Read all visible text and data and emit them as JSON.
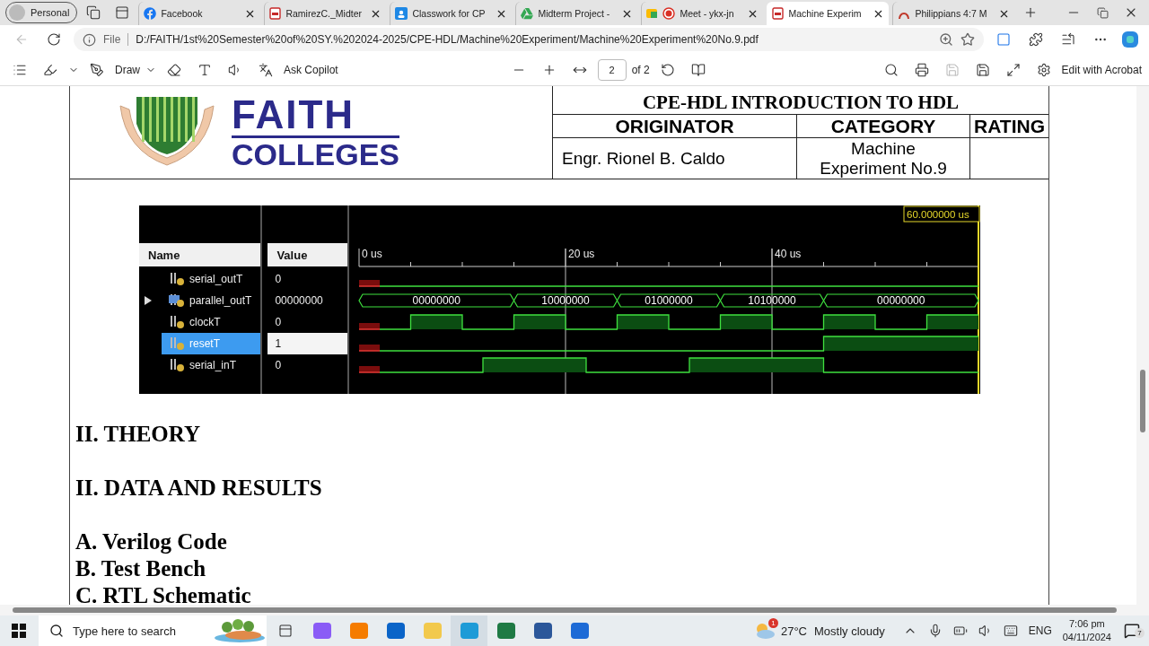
{
  "browser": {
    "profile": "Personal",
    "tabs": [
      {
        "label": "Facebook",
        "kind": "social",
        "selected": false
      },
      {
        "label": "RamirezC._Midter",
        "kind": "pdf",
        "selected": false
      },
      {
        "label": "Classwork for CP",
        "kind": "classroom",
        "selected": false
      },
      {
        "label": "Midterm Project -",
        "kind": "drive",
        "selected": false
      },
      {
        "label": "Meet - ykx-jn",
        "kind": "meet",
        "selected": false
      },
      {
        "label": "Machine Experim",
        "kind": "pdf",
        "selected": true
      },
      {
        "label": "Philippians 4:7 M",
        "kind": "arc",
        "selected": false
      }
    ],
    "address": {
      "scheme": "File",
      "url": "D:/FAITH/1st%20Semester%20of%20SY.%202024-2025/CPE-HDL/Machine%20Experiment/Machine%20Experiment%20No.9.pdf"
    }
  },
  "pdf_toolbar": {
    "draw": "Draw",
    "copilot": "Ask Copilot",
    "page": "2",
    "page_count": "of 2",
    "acrobat": "Edit with Acrobat"
  },
  "document": {
    "logo_top": "FAITH",
    "logo_bottom": "COLLEGES",
    "course": "CPE-HDL INTRODUCTION TO HDL",
    "columns": [
      "ORIGINATOR",
      "CATEGORY",
      "RATING"
    ],
    "values": [
      "Engr. Rionel B. Caldo",
      "Machine Experiment No.9"
    ],
    "simulation": {
      "name_header": "Name",
      "value_header": "Value",
      "time_labels": [
        "0 us",
        "20 us",
        "40 us"
      ],
      "cursor": "60.000000 us",
      "signals": [
        {
          "name": "serial_outT",
          "value": "0",
          "kind": "bit",
          "selected": false
        },
        {
          "name": "parallel_outT",
          "value": "00000000",
          "kind": "bus",
          "expanded": false,
          "selected": false,
          "segments": [
            "00000000",
            "10000000",
            "01000000",
            "10100000",
            "00000000"
          ]
        },
        {
          "name": "clockT",
          "value": "0",
          "kind": "bit",
          "selected": false
        },
        {
          "name": "resetT",
          "value": "1",
          "kind": "bit",
          "selected": true
        },
        {
          "name": "serial_inT",
          "value": "0",
          "kind": "bit",
          "selected": false
        }
      ]
    },
    "headings": [
      "II. THEORY",
      "II. DATA AND RESULTS"
    ],
    "items": [
      "A. Verilog Code",
      "B. Test Bench",
      "C. RTL Schematic"
    ]
  },
  "taskbar": {
    "search_placeholder": "Type here to search",
    "weather_badge": "1",
    "temperature": "27°C",
    "weather": "Mostly cloudy",
    "language": "ENG",
    "time": "7:06 pm",
    "date": "04/11/2024",
    "notifications": "7"
  }
}
